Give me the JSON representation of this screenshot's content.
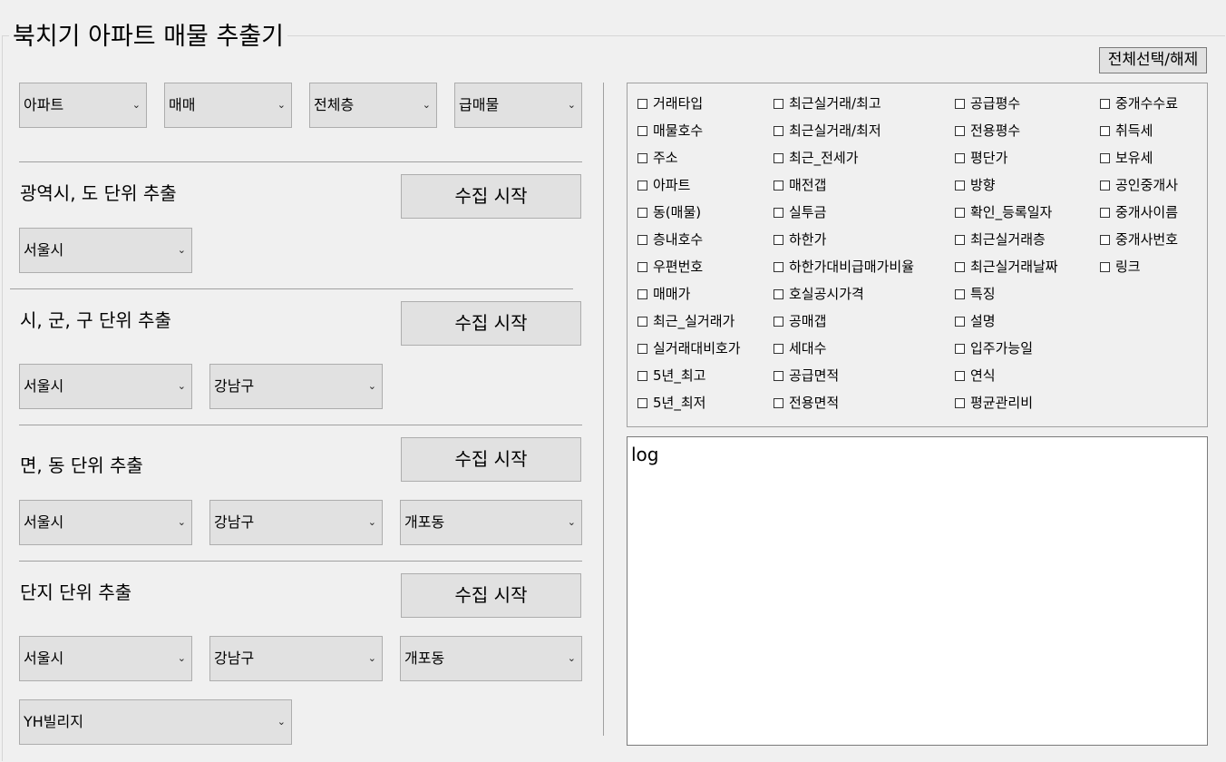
{
  "app": {
    "title": "북치기 아파트 매물 추출기"
  },
  "filters": [
    "아파트",
    "매매",
    "전체층",
    "급매물"
  ],
  "sections": [
    {
      "heading": "광역시, 도 단위 추출",
      "button": "수집 시작",
      "selects": [
        "서울시"
      ]
    },
    {
      "heading": "시, 군, 구 단위 추출",
      "button": "수집 시작",
      "selects": [
        "서울시",
        "강남구"
      ]
    },
    {
      "heading": "면, 동 단위 추출",
      "button": "수집 시작",
      "selects": [
        "서울시",
        "강남구",
        "개포동"
      ]
    },
    {
      "heading": "단지 단위 추출",
      "button": "수집 시작",
      "selects": [
        "서울시",
        "강남구",
        "개포동",
        "YH빌리지"
      ]
    }
  ],
  "select_all_button": "전체선택/해제",
  "columns": [
    [
      "거래타입",
      "매물호수",
      "주소",
      "아파트",
      "동(매물)",
      "층내호수",
      "우편번호",
      "매매가",
      "최근_실거래가",
      "실거래대비호가",
      "5년_최고",
      "5년_최저"
    ],
    [
      "최근실거래/최고",
      "최근실거래/최저",
      "최근_전세가",
      "매전갭",
      "실투금",
      "하한가",
      "하한가대비급매가비율",
      "호실공시가격",
      "공매갭",
      "세대수",
      "공급면적",
      "전용면적"
    ],
    [
      "공급평수",
      "전용평수",
      "평단가",
      "방향",
      "확인_등록일자",
      "최근실거래층",
      "최근실거래날짜",
      "특징",
      "설명",
      "입주가능일",
      "연식",
      "평균관리비"
    ],
    [
      "중개수수료",
      "취득세",
      "보유세",
      "공인중개사",
      "중개사이름",
      "중개사번호",
      "링크"
    ]
  ],
  "log": {
    "text": "log"
  }
}
